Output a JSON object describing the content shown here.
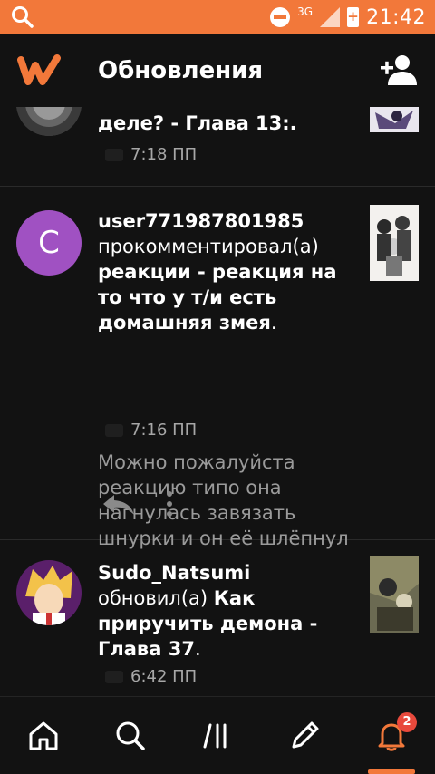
{
  "status_bar": {
    "network": "3G",
    "time": "21:42"
  },
  "app_bar": {
    "title": "Обновления"
  },
  "feed": [
    {
      "partial_line": "деле? - Глава 13:.",
      "time": "7:18 ПП"
    },
    {
      "avatar_letter": "C",
      "username": "user771987801985",
      "action": "прокомментировал(а)",
      "story_bold": "реакции - реакция на то что у т/и есть домашняя змея",
      "story_suffix": ".",
      "time": "7:16 ПП",
      "comment": "Можно пожалуйста реакцию  типо она нагнулась завязать шнурки и он её шлёпнул"
    },
    {
      "username": "Sudo_Natsumi",
      "action": "обновил(а)",
      "story_bold": "Как приручить демона - Глава 37",
      "story_suffix": ".",
      "time": "6:42 ПП"
    }
  ],
  "bottom_nav": {
    "notifications_badge": "2"
  },
  "colors": {
    "accent": "#f2783a",
    "background": "#121212",
    "badge": "#e8493c",
    "avatar_c": "#a051c2"
  }
}
